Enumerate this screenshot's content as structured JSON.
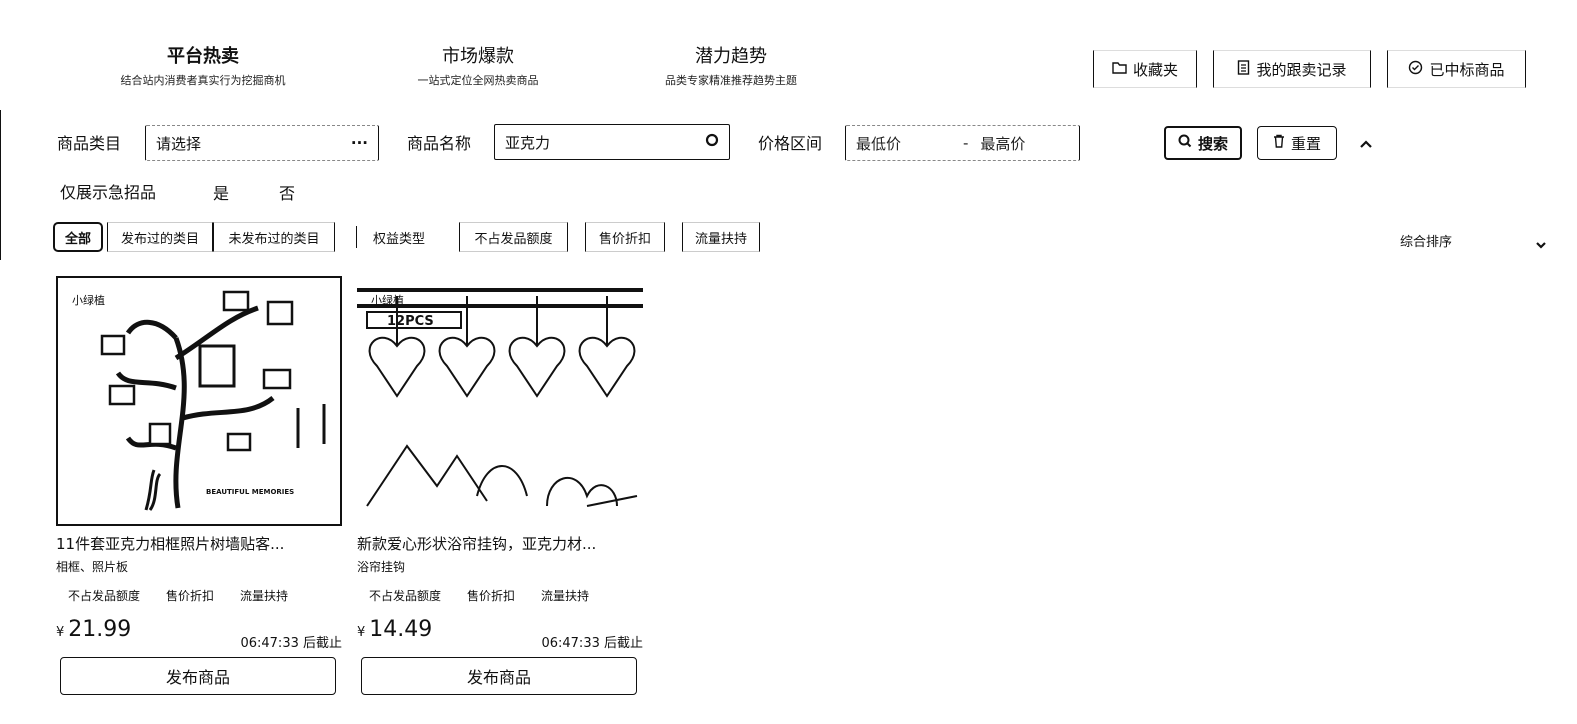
{
  "tabs": [
    {
      "title": "平台热卖",
      "subtitle": "结合站内消费者真实行为挖掘商机"
    },
    {
      "title": "市场爆款",
      "subtitle": "一站式定位全网热卖商品"
    },
    {
      "title": "潜力趋势",
      "subtitle": "品类专家精准推荐趋势主题"
    }
  ],
  "top_actions": {
    "favorites": "收藏夹",
    "records": "我的跟卖记录",
    "won": "已中标商品"
  },
  "filters": {
    "category_label": "商品类目",
    "category_value": "请选择",
    "name_label": "商品名称",
    "name_value": "亚克力",
    "price_label": "价格区间",
    "price_min_placeholder": "最低价",
    "price_separator": "-",
    "price_max_placeholder": "最高价",
    "search": "搜索",
    "reset": "重置",
    "urgent_label": "仅展示急招品",
    "urgent_yes": "是",
    "urgent_no": "否"
  },
  "chips": {
    "all": "全部",
    "published": "发布过的类目",
    "unpublished": "未发布过的类目",
    "rights": "权益类型",
    "quota": "不占发品额度",
    "discount": "售价折扣",
    "traffic": "流量扶持",
    "sort": "综合排序"
  },
  "products": [
    {
      "title": "11件套亚克力相框照片树墙贴客...",
      "category": "相框、照片板",
      "tags": [
        "不占发品额度",
        "售价折扣",
        "流量扶持"
      ],
      "currency": "¥",
      "price": "21.99",
      "deadline": "06:47:33 后截止",
      "button": "发布商品",
      "watermark": "小绿植",
      "caption": "BEAUTIFUL MEMORIES"
    },
    {
      "title": "新款爱心形状浴帘挂钩，亚克力材...",
      "category": "浴帘挂钩",
      "tags": [
        "不占发品额度",
        "售价折扣",
        "流量扶持"
      ],
      "currency": "¥",
      "price": "14.49",
      "deadline": "06:47:33 后截止",
      "button": "发布商品",
      "watermark": "小绿植",
      "badge": "12PCS"
    }
  ]
}
